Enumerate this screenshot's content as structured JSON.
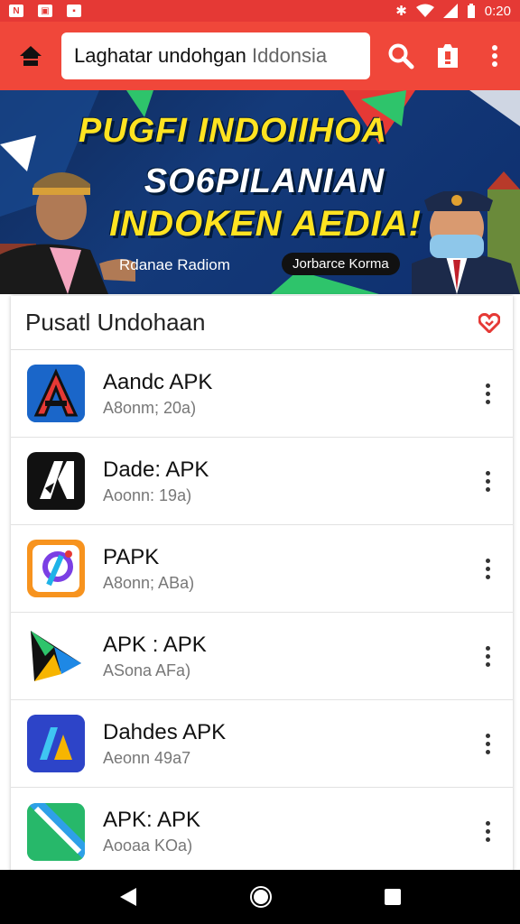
{
  "status_bar": {
    "time": "0:20",
    "icons": [
      "notification-icon",
      "image-icon",
      "doc-icon",
      "vibrate-icon",
      "wifi-icon",
      "signal-icon",
      "battery-icon"
    ]
  },
  "app_bar": {
    "search_text_main": "Laghatar undohgan",
    "search_text_muted": "Iddonsia"
  },
  "banner": {
    "line1": "PUGFI INDOIIHOA",
    "line2": "SO6PILANIAN",
    "line3": "INDOKEN AEDIA!",
    "caption_left": "Rdanae Radiom",
    "caption_right": "Jorbarce Korma"
  },
  "list": {
    "title": "Pusatl Undohaan",
    "items": [
      {
        "name": "Aandc APK",
        "sub": "A8onm; 20a)"
      },
      {
        "name": "Dade: APK",
        "sub": "Aoonn: 19a)"
      },
      {
        "name": "PAPK",
        "sub": "A8onn; ABa)"
      },
      {
        "name": "APK : APK",
        "sub": "ASona AFa)"
      },
      {
        "name": "Dahdes APK",
        "sub": "Aeonn 49a7"
      },
      {
        "name": "APK: APK",
        "sub": "Aooaa KOa)"
      }
    ]
  },
  "colors": {
    "accent": "#f0473a",
    "status_bar": "#e53935"
  }
}
